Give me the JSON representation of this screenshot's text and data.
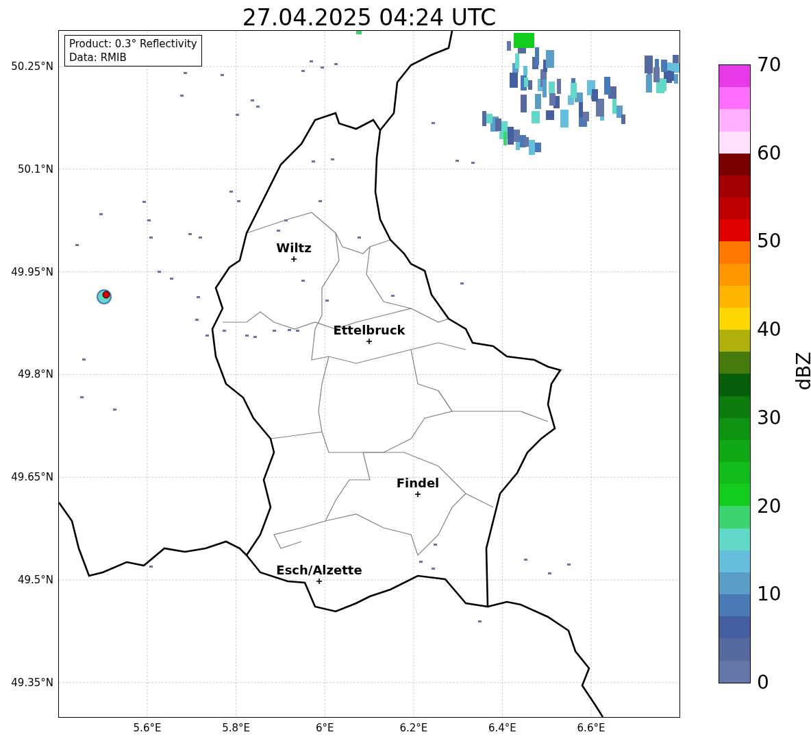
{
  "title": "27.04.2025 04:24 UTC",
  "info_box": {
    "lines": [
      "Product: 0.3° Reflectivity",
      "Data: RMIB"
    ]
  },
  "map": {
    "longitude_labels": [
      "5.6°E",
      "5.8°E",
      "6°E",
      "6.2°E",
      "6.4°E",
      "6.6°E"
    ],
    "latitude_labels": [
      "50.25°N",
      "50.1°N",
      "49.95°N",
      "49.8°N",
      "49.65°N",
      "49.5°N",
      "49.35°N"
    ],
    "cities": [
      {
        "name": "Wiltz"
      },
      {
        "name": "Ettelbruck"
      },
      {
        "name": "Findel"
      },
      {
        "name": "Esch/Alzette"
      }
    ]
  },
  "colorbar": {
    "label": "dBZ",
    "tick_labels": [
      "70",
      "60",
      "50",
      "40",
      "30",
      "20",
      "10",
      "0"
    ],
    "segments": [
      {
        "color": "#6577a8"
      },
      {
        "color": "#556a9e"
      },
      {
        "color": "#445ea0"
      },
      {
        "color": "#4a7ab5"
      },
      {
        "color": "#5a9ec8"
      },
      {
        "color": "#64bedc"
      },
      {
        "color": "#62d8c8"
      },
      {
        "color": "#3cd46e"
      },
      {
        "color": "#14cc1e"
      },
      {
        "color": "#12bc1a"
      },
      {
        "color": "#10a814"
      },
      {
        "color": "#0e9410"
      },
      {
        "color": "#0c7c0e"
      },
      {
        "color": "#065e0a"
      },
      {
        "color": "#467a0a"
      },
      {
        "color": "#b0b00a"
      },
      {
        "color": "#ffd700"
      },
      {
        "color": "#ffb400"
      },
      {
        "color": "#ff9800"
      },
      {
        "color": "#ff7800"
      },
      {
        "color": "#e00000"
      },
      {
        "color": "#c00000"
      },
      {
        "color": "#a00000"
      },
      {
        "color": "#7a0000"
      },
      {
        "color": "#ffe0ff"
      },
      {
        "color": "#ffb0ff"
      },
      {
        "color": "#ff6eff"
      },
      {
        "color": "#e838e8"
      }
    ]
  }
}
